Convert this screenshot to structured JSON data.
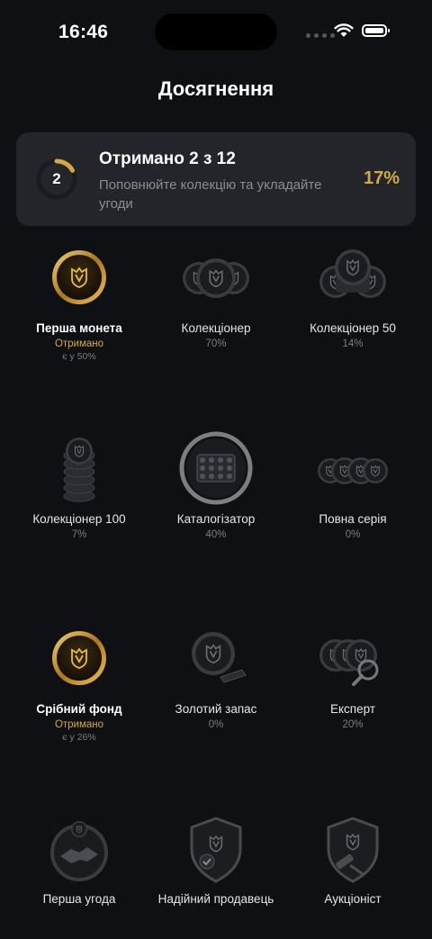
{
  "status_bar": {
    "time": "16:46"
  },
  "page": {
    "title": "Досягнення"
  },
  "summary": {
    "count": "2",
    "title": "Отримано 2 з 12",
    "subtitle": "Поповнюйте колекцію та укладайте угоди",
    "percent": "17%",
    "progress_fraction": 0.17,
    "accent_color": "#d6a745"
  },
  "achievements": [
    {
      "name": "Перша монета",
      "status": "Отримано",
      "owned": "є у 50%",
      "earned": true,
      "icon": "gold-coin-icon"
    },
    {
      "name": "Колекціонер",
      "status": "70%",
      "earned": false,
      "icon": "coin-trio-icon"
    },
    {
      "name": "Колекціонер 50",
      "status": "14%",
      "earned": false,
      "icon": "coin-pile-icon"
    },
    {
      "name": "Колекціонер 100",
      "status": "7%",
      "earned": false,
      "icon": "coin-tower-icon"
    },
    {
      "name": "Каталогізатор",
      "status": "40%",
      "earned": false,
      "icon": "album-icon"
    },
    {
      "name": "Повна серія",
      "status": "0%",
      "earned": false,
      "icon": "coin-row-icon"
    },
    {
      "name": "Срібний фонд",
      "status": "Отримано",
      "owned": "є у 26%",
      "earned": true,
      "icon": "gold-coin-icon"
    },
    {
      "name": "Золотий запас",
      "status": "0%",
      "earned": false,
      "icon": "coin-bar-icon"
    },
    {
      "name": "Експерт",
      "status": "20%",
      "earned": false,
      "icon": "magnifier-coins-icon"
    },
    {
      "name": "Перша угода",
      "status": "",
      "earned": false,
      "icon": "handshake-icon"
    },
    {
      "name": "Надійний продавець",
      "status": "",
      "earned": false,
      "icon": "shield-check-icon"
    },
    {
      "name": "Аукціоніст",
      "status": "",
      "earned": false,
      "icon": "gavel-shield-icon"
    }
  ]
}
